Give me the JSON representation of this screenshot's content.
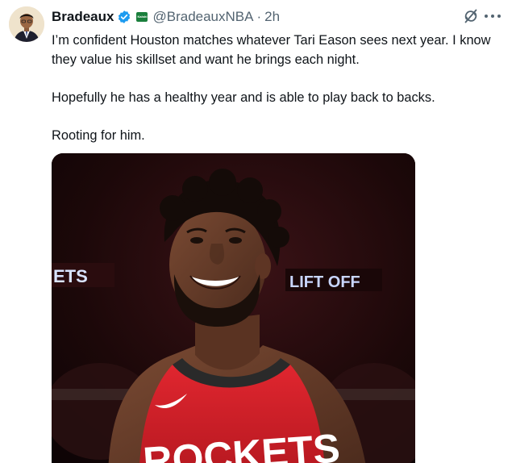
{
  "tweet": {
    "author_name": "Bradeaux",
    "handle": "@BradeauxNBA",
    "separator": "·",
    "time": "2h",
    "affiliate_badge_text": "Kalshi",
    "paragraphs": [
      "I’m confident Houston matches whatever Tari Eason sees next year. I know they value his skillset and want he brings each night.",
      "Hopefully he has a healthy year and is able to play back to backs.",
      "Rooting for him."
    ]
  },
  "media": {
    "jersey_text": "ROCKETS",
    "banner_left_text": "ETS",
    "banner_right_text": "LIFT OFF",
    "colors": {
      "jersey_red": "#d4222b",
      "arena_dark": "#160708"
    }
  },
  "icons": {
    "verified": "verified-badge-icon",
    "grok": "grok-icon",
    "more": "more-options-icon"
  },
  "colors": {
    "text_primary": "#0f1419",
    "text_secondary": "#536471",
    "verified_blue": "#1d9bf0"
  }
}
